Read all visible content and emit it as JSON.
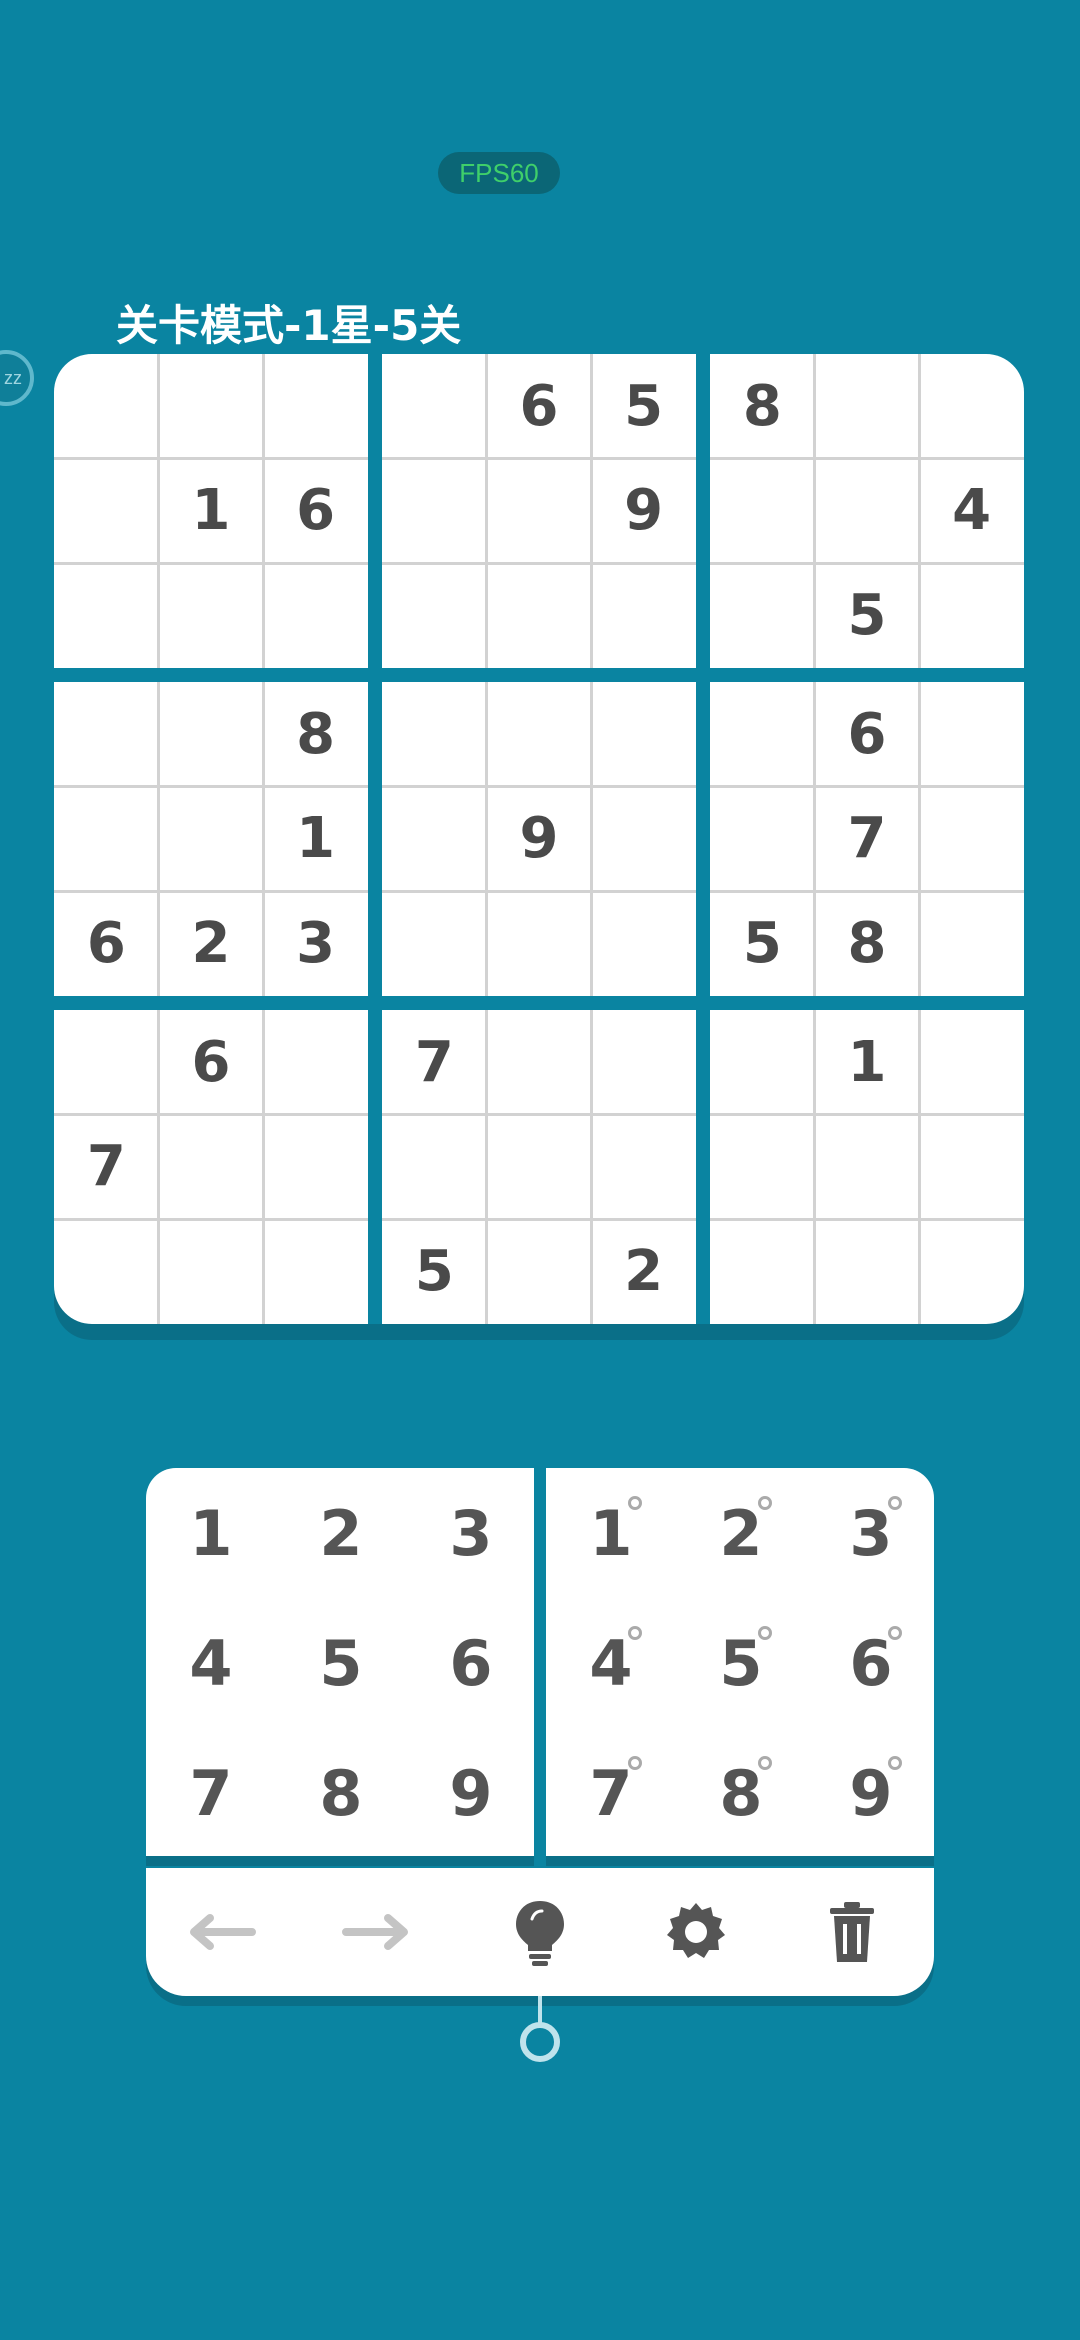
{
  "status": {
    "fps_label": "FPS60"
  },
  "float_button": {
    "label": "zz"
  },
  "header": {
    "title": "关卡模式-1星-5关"
  },
  "board": {
    "grid": [
      [
        "",
        "",
        "",
        "",
        "6",
        "5",
        "8",
        "",
        ""
      ],
      [
        "",
        "1",
        "6",
        "",
        "",
        "9",
        "",
        "",
        "4"
      ],
      [
        "",
        "",
        "",
        "",
        "",
        "",
        "",
        "5",
        ""
      ],
      [
        "",
        "",
        "8",
        "",
        "",
        "",
        "",
        "6",
        ""
      ],
      [
        "",
        "",
        "1",
        "",
        "9",
        "",
        "",
        "7",
        ""
      ],
      [
        "6",
        "2",
        "3",
        "",
        "",
        "",
        "5",
        "8",
        ""
      ],
      [
        "",
        "6",
        "",
        "7",
        "",
        "",
        "",
        "1",
        ""
      ],
      [
        "7",
        "",
        "",
        "",
        "",
        "",
        "",
        "",
        ""
      ],
      [
        "",
        "",
        "",
        "5",
        "",
        "2",
        "",
        "",
        ""
      ]
    ]
  },
  "number_pad": {
    "fill_keys": [
      "1",
      "2",
      "3",
      "4",
      "5",
      "6",
      "7",
      "8",
      "9"
    ],
    "note_keys": [
      "1",
      "2",
      "3",
      "4",
      "5",
      "6",
      "7",
      "8",
      "9"
    ]
  },
  "toolbar": {
    "items": [
      {
        "name": "undo-button",
        "icon": "arrow-left-icon",
        "enabled": false
      },
      {
        "name": "redo-button",
        "icon": "arrow-right-icon",
        "enabled": false
      },
      {
        "name": "hint-button",
        "icon": "lightbulb-icon",
        "enabled": true
      },
      {
        "name": "settings-button",
        "icon": "gear-icon",
        "enabled": true
      },
      {
        "name": "delete-button",
        "icon": "trash-icon",
        "enabled": true
      }
    ]
  },
  "colors": {
    "background": "#0a84a1",
    "board": "#ffffff",
    "digit": "#4a4a4a",
    "fps_text": "#3fcf6a",
    "disabled_icon": "#c4c4c4",
    "enabled_icon": "#555555"
  }
}
